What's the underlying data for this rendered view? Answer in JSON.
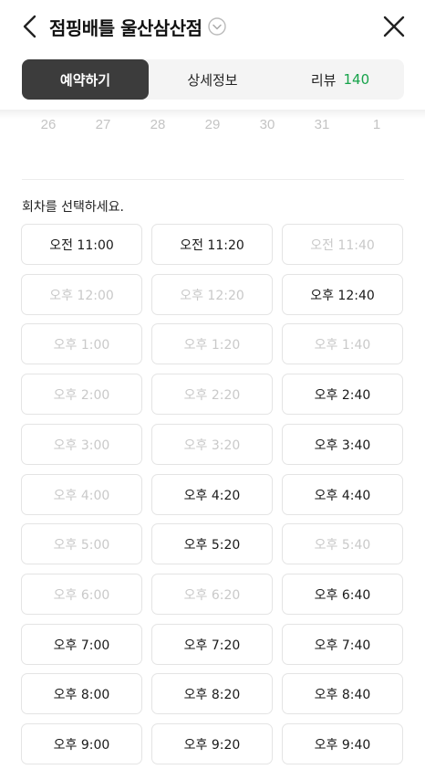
{
  "header": {
    "title": "점핑배틀 울산삼산점"
  },
  "tabs": [
    {
      "label": "예약하기",
      "active": true
    },
    {
      "label": "상세정보",
      "active": false
    },
    {
      "label": "리뷰",
      "count": "140",
      "active": false
    }
  ],
  "dates": [
    "26",
    "27",
    "28",
    "29",
    "30",
    "31",
    "1"
  ],
  "section_label": "회차를 선택하세요.",
  "slots": [
    {
      "label": "오전 11:00",
      "available": true
    },
    {
      "label": "오전 11:20",
      "available": true
    },
    {
      "label": "오전 11:40",
      "available": false
    },
    {
      "label": "오후 12:00",
      "available": false
    },
    {
      "label": "오후 12:20",
      "available": false
    },
    {
      "label": "오후 12:40",
      "available": true
    },
    {
      "label": "오후 1:00",
      "available": false
    },
    {
      "label": "오후 1:20",
      "available": false
    },
    {
      "label": "오후 1:40",
      "available": false
    },
    {
      "label": "오후 2:00",
      "available": false
    },
    {
      "label": "오후 2:20",
      "available": false
    },
    {
      "label": "오후 2:40",
      "available": true
    },
    {
      "label": "오후 3:00",
      "available": false
    },
    {
      "label": "오후 3:20",
      "available": false
    },
    {
      "label": "오후 3:40",
      "available": true
    },
    {
      "label": "오후 4:00",
      "available": false
    },
    {
      "label": "오후 4:20",
      "available": true
    },
    {
      "label": "오후 4:40",
      "available": true
    },
    {
      "label": "오후 5:00",
      "available": false
    },
    {
      "label": "오후 5:20",
      "available": true
    },
    {
      "label": "오후 5:40",
      "available": false
    },
    {
      "label": "오후 6:00",
      "available": false
    },
    {
      "label": "오후 6:20",
      "available": false
    },
    {
      "label": "오후 6:40",
      "available": true
    },
    {
      "label": "오후 7:00",
      "available": true
    },
    {
      "label": "오후 7:20",
      "available": true
    },
    {
      "label": "오후 7:40",
      "available": true
    },
    {
      "label": "오후 8:00",
      "available": true
    },
    {
      "label": "오후 8:20",
      "available": true
    },
    {
      "label": "오후 8:40",
      "available": true
    },
    {
      "label": "오후 9:00",
      "available": true
    },
    {
      "label": "오후 9:20",
      "available": true
    },
    {
      "label": "오후 9:40",
      "available": true
    }
  ],
  "colors": {
    "active_tab_bg": "#3c3c3c",
    "review_count": "#16a34a",
    "disabled_text": "#c9c9c9"
  }
}
